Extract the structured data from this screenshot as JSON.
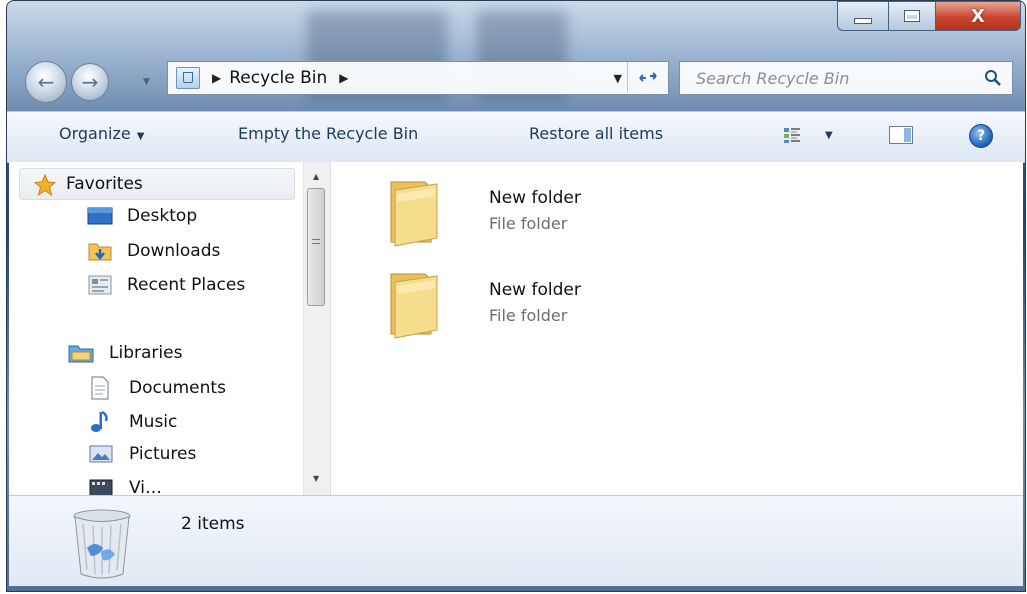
{
  "window": {
    "caption_buttons": [
      "minimize",
      "maximize",
      "close"
    ],
    "close_glyph": "X",
    "accent_close": "#c8452f"
  },
  "nav": {
    "back_icon": "back-arrow-icon",
    "forward_icon": "forward-arrow-icon"
  },
  "address": {
    "location": "Recycle Bin",
    "breadcrumb_sep": "▶",
    "trailing_sep": "▶",
    "dropdown": "▼",
    "refresh": "↻"
  },
  "search": {
    "placeholder": "Search Recycle Bin"
  },
  "toolbar": {
    "organize": "Organize",
    "organize_caret": "▼",
    "empty_bin": "Empty the Recycle Bin",
    "restore_all": "Restore all items",
    "view_caret": "▼",
    "help": "?"
  },
  "navpane": {
    "favorites": "Favorites",
    "desktop": "Desktop",
    "downloads": "Downloads",
    "recent_places": "Recent Places",
    "libraries": "Libraries",
    "documents": "Documents",
    "music": "Music",
    "pictures": "Pictures",
    "videos_partial": "Vi…",
    "scroll_up": "▲",
    "scroll_down": "▼"
  },
  "files": [
    {
      "name": "New folder",
      "type": "File folder"
    },
    {
      "name": "New folder",
      "type": "File folder"
    }
  ],
  "details": {
    "item_count": "2 items"
  },
  "colors": {
    "toolbar_text": "#1e395b",
    "folder_yellow": "#f3d27a",
    "file_type_gray": "#6d6d6d"
  }
}
